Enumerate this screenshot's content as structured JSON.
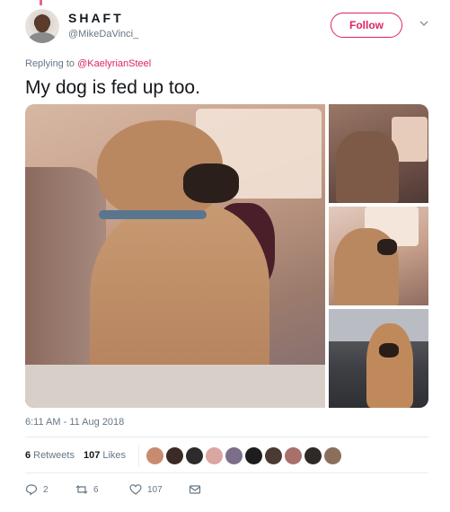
{
  "user": {
    "name": "SHAFT",
    "handle": "@MikeDaVinci_"
  },
  "follow_label": "Follow",
  "reply_context": {
    "prefix": "Replying to ",
    "mention": "@KaelyrianSteel"
  },
  "tweet": {
    "text": "My dog is fed up too.",
    "timestamp": "6:11 AM - 11 Aug 2018"
  },
  "stats": {
    "retweets_count": "6",
    "retweets_label": "Retweets",
    "likes_count": "107",
    "likes_label": "Likes"
  },
  "likers": [
    "#c98b6f",
    "#3b2a26",
    "#2b2b2b",
    "#d9a6a1",
    "#7a6e8a",
    "#1d1d1f",
    "#4a3a33",
    "#a8706a",
    "#2f2a28",
    "#8a6f5c"
  ],
  "actions": {
    "replies": "2",
    "retweets": "6",
    "likes": "107"
  },
  "colors": {
    "accent": "#e0245e",
    "muted": "#657786",
    "text": "#14171a"
  }
}
